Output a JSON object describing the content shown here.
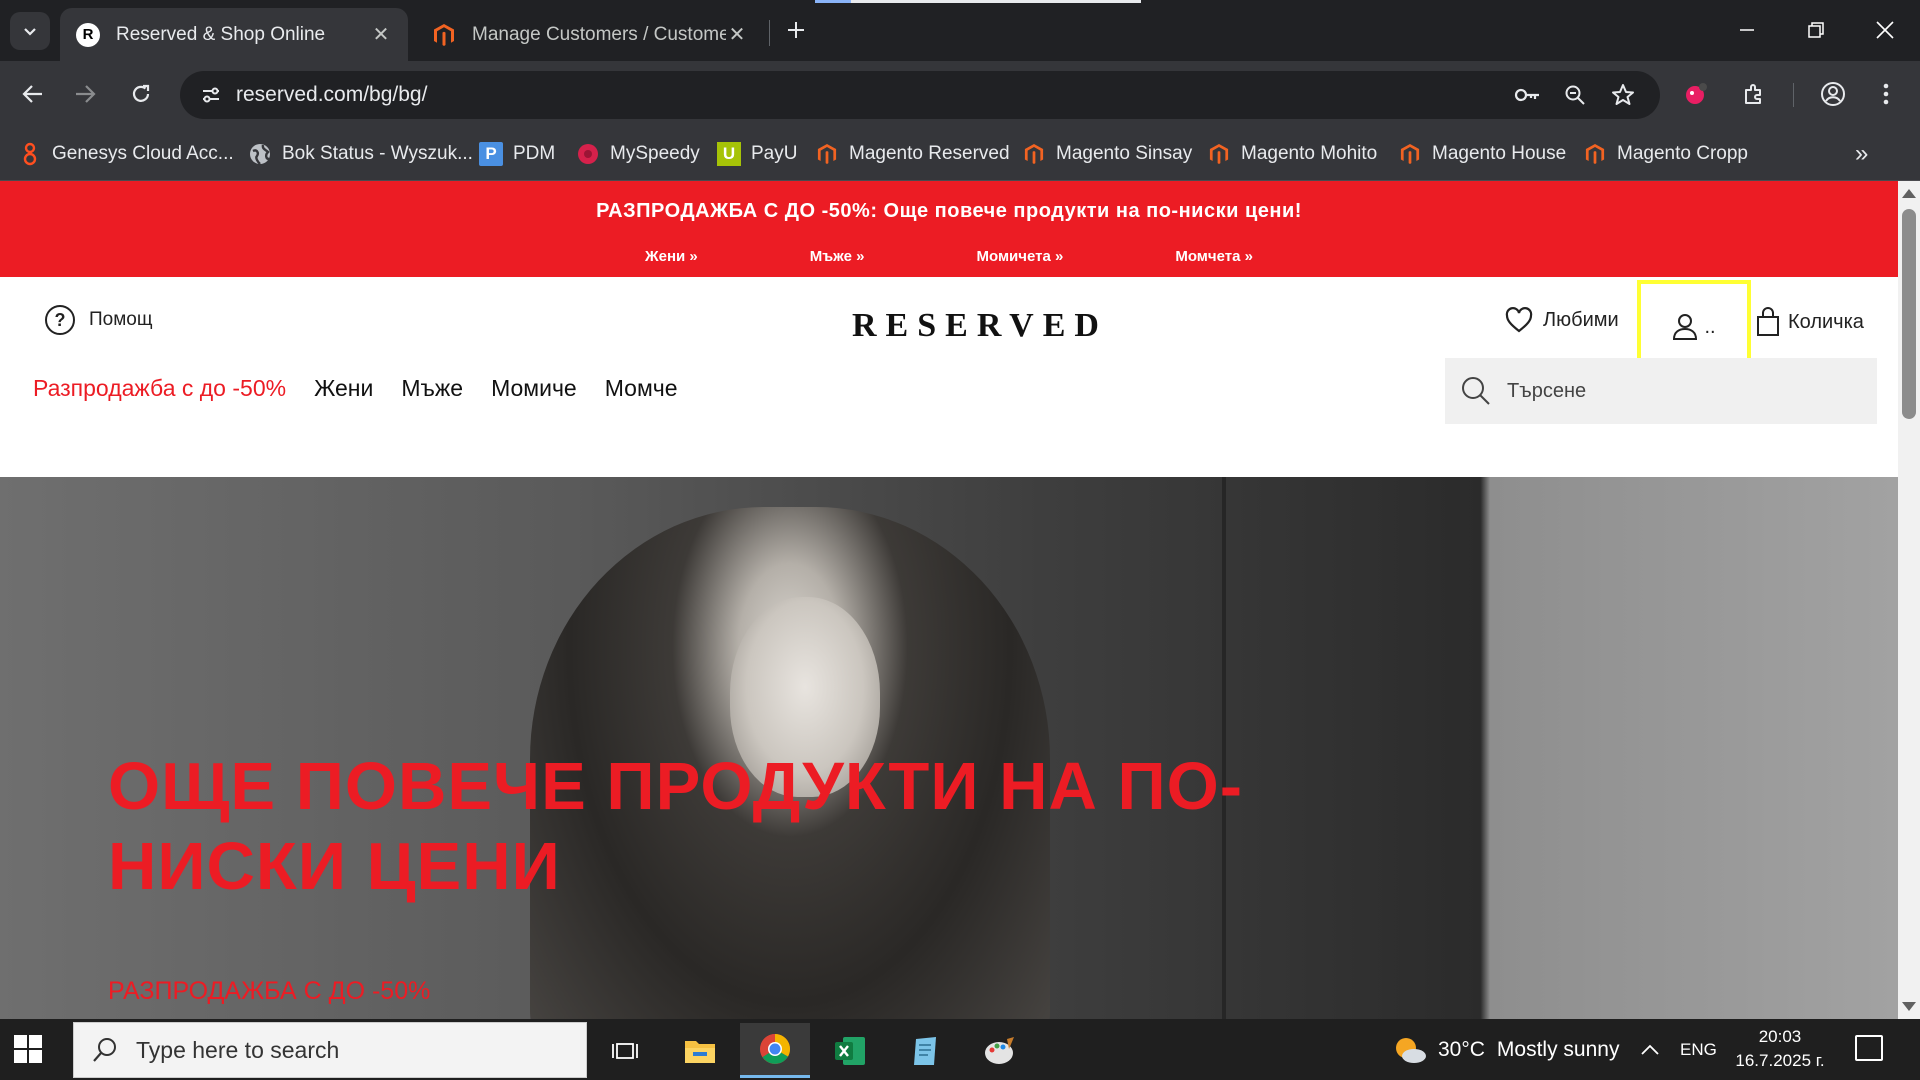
{
  "browser": {
    "tabs": [
      {
        "title": "Reserved & Shop Online",
        "active": true
      },
      {
        "title": "Manage Customers / Customer",
        "active": false
      }
    ],
    "url": "reserved.com/bg/bg/",
    "bookmarks": [
      {
        "label": "Genesys Cloud Acc...",
        "icon": "genesys-icon"
      },
      {
        "label": "Bok Status - Wyszuk...",
        "icon": "globe-icon"
      },
      {
        "label": "PDM",
        "icon": "pdm-icon"
      },
      {
        "label": "MySpeedy",
        "icon": "myspeedy-icon"
      },
      {
        "label": "PayU",
        "icon": "payu-icon"
      },
      {
        "label": "Magento Reserved",
        "icon": "magento-icon"
      },
      {
        "label": "Magento Sinsay",
        "icon": "magento-icon"
      },
      {
        "label": "Magento Mohito",
        "icon": "magento-icon"
      },
      {
        "label": "Magento House",
        "icon": "magento-icon"
      },
      {
        "label": "Magento Cropp",
        "icon": "magento-icon"
      }
    ]
  },
  "site": {
    "promo": {
      "headline": "РАЗПРОДАЖБА С ДО -50%: Още повече продукти на по-ниски цени!",
      "links": [
        "Жени »",
        "Мъже »",
        "Момичета »",
        "Момчета »"
      ]
    },
    "header": {
      "help": "Помощ",
      "logo": "RESERVED",
      "favorites": "Любими",
      "account": "..",
      "cart": "Количка"
    },
    "nav": {
      "sale": "Разпродажба с до -50%",
      "items": [
        "Жени",
        "Мъже",
        "Момиче",
        "Момче"
      ]
    },
    "search": {
      "placeholder": "Търсене"
    },
    "hero": {
      "title": "ОЩЕ ПОВЕЧЕ ПРОДУКТИ НА ПО-НИСКИ ЦЕНИ",
      "subtitle": "РАЗПРОДАЖБА С ДО -50%"
    }
  },
  "taskbar": {
    "search_placeholder": "Type here to search",
    "weather": {
      "temp": "30°C",
      "desc": "Mostly sunny"
    },
    "lang": "ENG",
    "time": "20:03",
    "date": "16.7.2025 г."
  },
  "colors": {
    "brand_red": "#ec1c24",
    "highlight": "#ffff33"
  }
}
